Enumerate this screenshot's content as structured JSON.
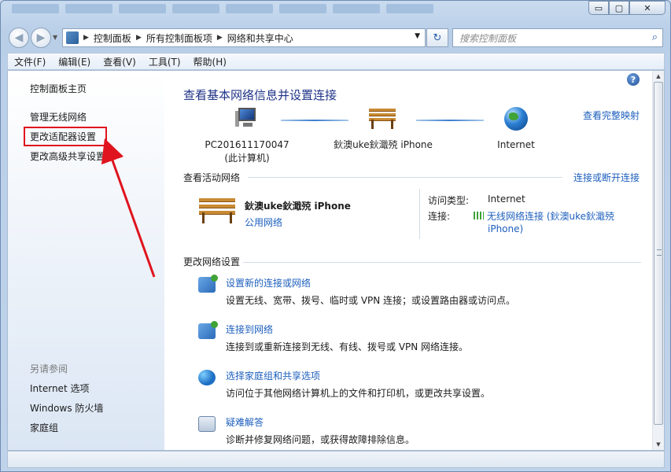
{
  "window": {
    "minimize_label": "▭",
    "maximize_label": "▢",
    "close_label": "✕"
  },
  "nav": {
    "back_label": "◀",
    "forward_label": "▶",
    "breadcrumbs": [
      "控制面板",
      "所有控制面板项",
      "网络和共享中心"
    ],
    "search_placeholder": "搜索控制面板"
  },
  "menu": {
    "items": [
      "文件(F)",
      "编辑(E)",
      "查看(V)",
      "工具(T)",
      "帮助(H)"
    ]
  },
  "sidebar": {
    "items": [
      "控制面板主页",
      "管理无线网络",
      "更改适配器设置",
      "更改高级共享设置"
    ],
    "see_also_header": "另请参阅",
    "see_also": [
      "Internet 选项",
      "Windows 防火墙",
      "家庭组"
    ]
  },
  "content": {
    "title": "查看基本网络信息并设置连接",
    "full_map_link": "查看完整映射",
    "map": {
      "computer_name": "PC201611170047",
      "computer_sub": "(此计算机)",
      "network_name": "鈥澳uke鈥濈殑 iPhone",
      "internet_label": "Internet"
    },
    "active_header": "查看活动网络",
    "connect_disconnect_link": "连接或断开连接",
    "active_network": {
      "name": "鈥澳uke鈥濈殑 iPhone",
      "type": "公用网络",
      "access_type_label": "访问类型:",
      "access_type_value": "Internet",
      "connection_label": "连接:",
      "connection_value_1": "无线网络连接 (鈥澳uke鈥濈殑",
      "connection_value_2": "iPhone)"
    },
    "change_header": "更改网络设置",
    "tasks": [
      {
        "title": "设置新的连接或网络",
        "desc": "设置无线、宽带、拨号、临时或 VPN 连接；或设置路由器或访问点。"
      },
      {
        "title": "连接到网络",
        "desc": "连接到或重新连接到无线、有线、拨号或 VPN 网络连接。"
      },
      {
        "title": "选择家庭组和共享选项",
        "desc": "访问位于其他网络计算机上的文件和打印机，或更改共享设置。"
      },
      {
        "title": "疑难解答",
        "desc": "诊断并修复网络问题，或获得故障排除信息。"
      }
    ]
  },
  "colors": {
    "link": "#1d5fbd",
    "title": "#1e3287",
    "highlight_box": "#e0141e",
    "annotation_arrow": "#e0141e"
  },
  "icons": {
    "help": "?",
    "search": "⌕",
    "refresh": "↻"
  }
}
